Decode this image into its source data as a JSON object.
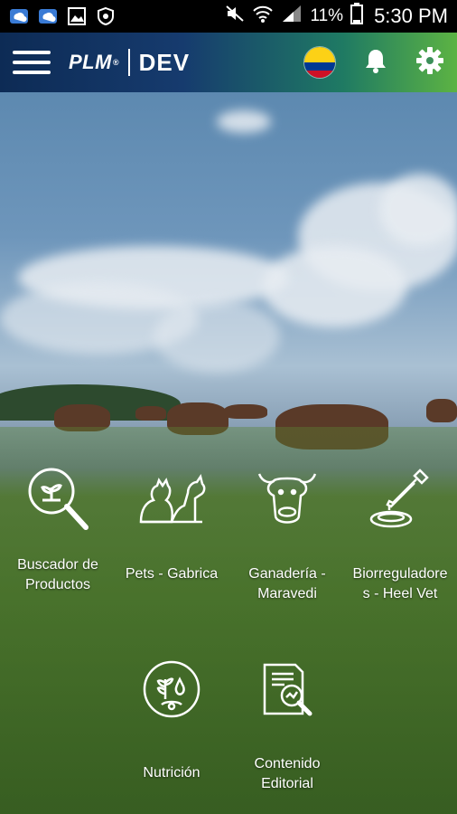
{
  "status_bar": {
    "battery": "11%",
    "time": "5:30 PM"
  },
  "app_bar": {
    "brand": "PLM",
    "registered": "®",
    "env": "DEV",
    "country_flag": "colombia-flag"
  },
  "tiles": [
    {
      "label": "Buscador de\nProductos",
      "icon": "search-products-icon"
    },
    {
      "label": "Pets - Gabrica",
      "icon": "pets-icon"
    },
    {
      "label": "Ganadería -\nMaravedi",
      "icon": "cattle-icon"
    },
    {
      "label": "Biorreguladore\ns - Heel Vet",
      "icon": "dropper-icon"
    },
    {
      "label": "Nutrición",
      "icon": "nutrition-icon"
    },
    {
      "label": "Contenido\nEditorial",
      "icon": "editorial-icon"
    }
  ]
}
